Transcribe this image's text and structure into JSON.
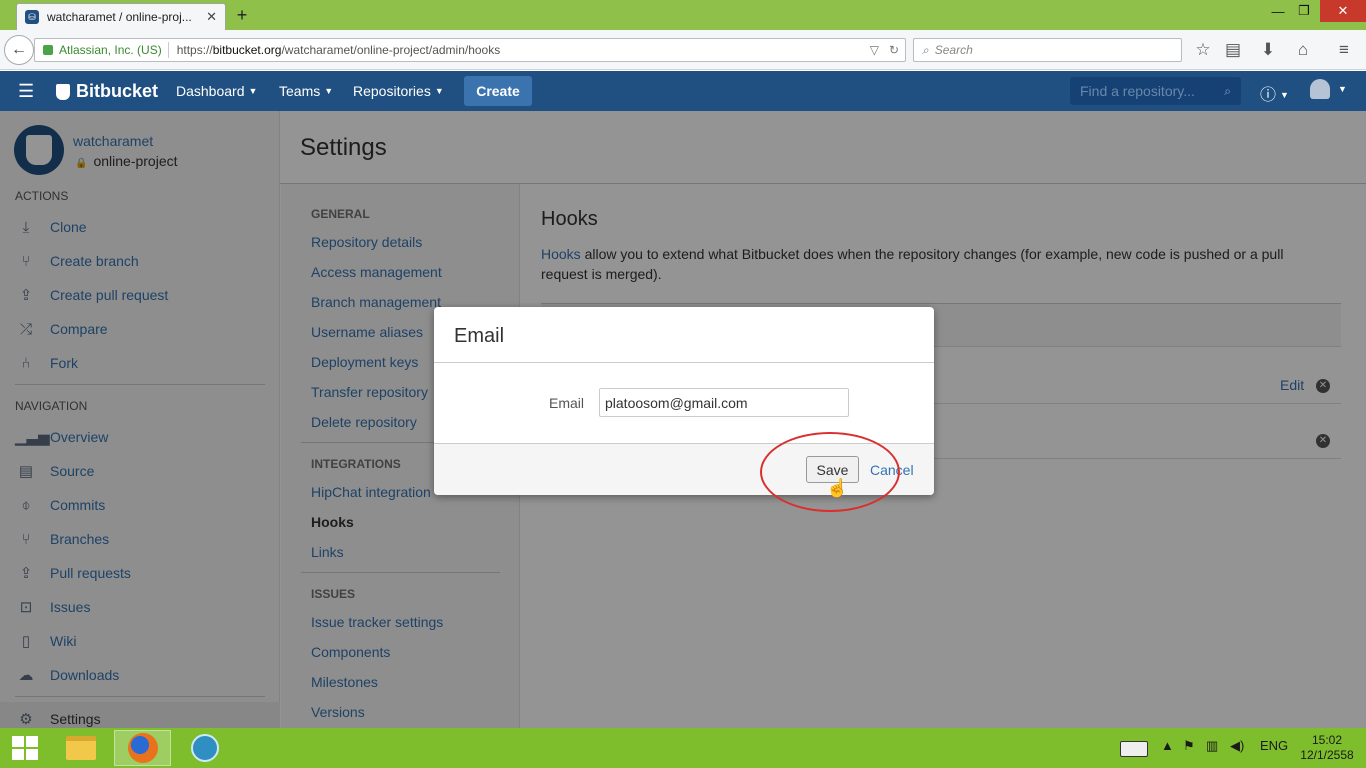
{
  "browser": {
    "tab_title": "watcharamet / online-proj...",
    "new_tab": "+",
    "identity": "Atlassian, Inc. (US)",
    "url_prefix": "https://",
    "url_domain": "bitbucket.org",
    "url_path": "/watcharamet/online-project/admin/hooks",
    "search_placeholder": "Search"
  },
  "header": {
    "logo": "Bitbucket",
    "nav": [
      "Dashboard",
      "Teams",
      "Repositories"
    ],
    "create": "Create",
    "find_placeholder": "Find a repository..."
  },
  "repo": {
    "owner": "watcharamet",
    "name": "online-project"
  },
  "sidebar": {
    "actions_heading": "ACTIONS",
    "actions": [
      {
        "label": "Clone",
        "icon": "clone-icon"
      },
      {
        "label": "Create branch",
        "icon": "create-branch-icon"
      },
      {
        "label": "Create pull request",
        "icon": "create-pull-request-icon"
      },
      {
        "label": "Compare",
        "icon": "compare-icon"
      },
      {
        "label": "Fork",
        "icon": "fork-icon"
      }
    ],
    "navigation_heading": "NAVIGATION",
    "navigation": [
      {
        "label": "Overview",
        "icon": "overview-icon"
      },
      {
        "label": "Source",
        "icon": "source-icon"
      },
      {
        "label": "Commits",
        "icon": "commits-icon"
      },
      {
        "label": "Branches",
        "icon": "branches-icon"
      },
      {
        "label": "Pull requests",
        "icon": "pull-requests-icon"
      },
      {
        "label": "Issues",
        "icon": "issues-icon"
      },
      {
        "label": "Wiki",
        "icon": "wiki-icon"
      },
      {
        "label": "Downloads",
        "icon": "downloads-icon"
      }
    ],
    "settings": "Settings"
  },
  "settings": {
    "title": "Settings",
    "general_heading": "GENERAL",
    "general": [
      "Repository details",
      "Access management",
      "Branch management",
      "Username aliases",
      "Deployment keys",
      "Transfer repository",
      "Delete repository"
    ],
    "integrations_heading": "INTEGRATIONS",
    "integrations": [
      "HipChat integration",
      "Hooks",
      "Links"
    ],
    "issues_heading": "ISSUES",
    "issues": [
      "Issue tracker settings",
      "Components",
      "Milestones",
      "Versions"
    ]
  },
  "hooks": {
    "title": "Hooks",
    "desc_link": "Hooks",
    "desc_rest": " allow you to extend what Bitbucket does when the repository changes (for example, new code is pushed or a pull request is merged).",
    "edit": "Edit"
  },
  "dialog": {
    "title": "Email",
    "field_label": "Email",
    "field_value": "platoosom@gmail.com",
    "save": "Save",
    "cancel": "Cancel"
  },
  "taskbar": {
    "lang": "ENG",
    "time": "15:02",
    "date": "12/1/2558"
  },
  "colors": {
    "header_blue": "#205081",
    "link_blue": "#3572b0",
    "taskbar_green": "#7ebe2d",
    "annotation_red": "#d8302f"
  }
}
